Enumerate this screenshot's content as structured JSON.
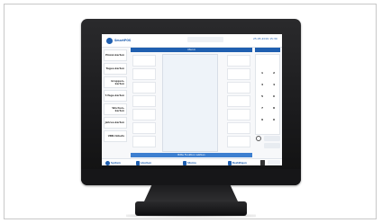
{
  "screen": {
    "logo": "SmartPOS",
    "datetime": "25.05.2019 15:30",
    "left_buttons": [
      "Einzel-karten",
      "Tages-karten",
      "Gruppen-karten",
      "7-Tage-karten",
      "Wochen-karten",
      "Jahres-karten",
      "VBB-tickets"
    ],
    "middle_header": "Menü",
    "middle_footer": "Bitte Funktion wählen",
    "keypad": [
      "1",
      "2",
      "3",
      "4",
      "5",
      "6",
      "7",
      "8",
      "9",
      "0"
    ],
    "bottom_bar": [
      "System",
      "Löschen",
      "Storno",
      "Bestätigen"
    ]
  },
  "colors": {
    "accent": "#1f5fb0",
    "accent_light": "#3d7fd0"
  }
}
